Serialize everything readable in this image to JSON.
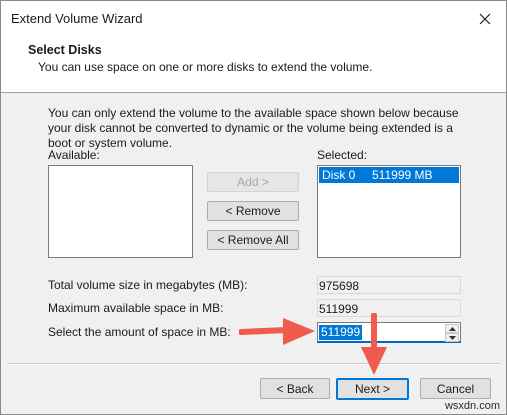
{
  "window": {
    "title": "Extend Volume Wizard"
  },
  "header": {
    "title": "Select Disks",
    "subtitle": "You can use space on one or more disks to extend the volume."
  },
  "info_text": "You can only extend the volume to the available space shown below because your disk cannot be converted to dynamic or the volume being extended is a boot or system volume.",
  "available": {
    "label": "Available:",
    "items": []
  },
  "selected": {
    "label": "Selected:",
    "items": [
      "Disk 0     511999 MB"
    ]
  },
  "buttons": {
    "add": "Add >",
    "remove": "< Remove",
    "remove_all": "< Remove All",
    "back": "< Back",
    "next": "Next >",
    "cancel": "Cancel"
  },
  "fields": {
    "total_label": "Total volume size in megabytes (MB):",
    "total_value": "975698",
    "max_label": "Maximum available space in MB:",
    "max_value": "511999",
    "amount_label": "Select the amount of space in MB:",
    "amount_value": "511999"
  },
  "icons": {
    "close": "close-icon",
    "spin_up": "chevron-up-icon",
    "spin_down": "chevron-down-icon",
    "annotation_right": "red-arrow-right-icon",
    "annotation_down": "red-arrow-down-icon"
  },
  "colors": {
    "selection": "#0078d7",
    "annotation_arrow": "#ef5b4c"
  },
  "watermark": "wsxdn.com"
}
